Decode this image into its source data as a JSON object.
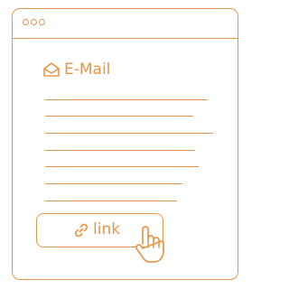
{
  "window": {
    "window_controls": [
      "dot",
      "dot",
      "dot"
    ]
  },
  "email": {
    "title": "E-Mail",
    "title_icon": "envelope-open-icon",
    "text_lines": 7
  },
  "link_button": {
    "label": "link",
    "icon": "chain-link-icon"
  },
  "cursor": {
    "icon": "hand-pointer-icon"
  },
  "colors": {
    "accent": "#e8954a",
    "background": "#ffffff"
  }
}
